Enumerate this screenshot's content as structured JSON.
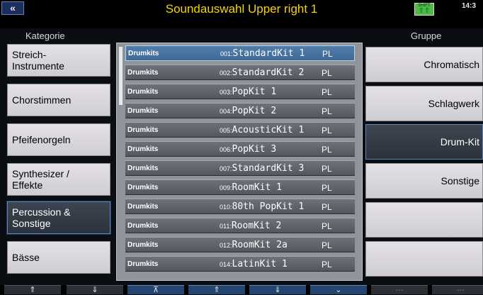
{
  "window": {
    "back_label": "«",
    "title": "Soundauswahl Upper right 1",
    "shift_label": "SHIFT",
    "shift_arrows": "⇑⇑",
    "clock": "14:3"
  },
  "headers": {
    "left": "Kategorie",
    "right": "Gruppe"
  },
  "categories": [
    {
      "label": "Streich-\nInstrumente"
    },
    {
      "label": "Chorstimmen"
    },
    {
      "label": "Pfeifenorgeln"
    },
    {
      "label": "Synthesizer /\nEffekte"
    },
    {
      "label": "Percussion &\nSonstige",
      "active": true
    },
    {
      "label": "Bässe"
    }
  ],
  "sounds": [
    {
      "category": "Drumkits",
      "num": "001:",
      "name": "StandardKit 1",
      "tag": "PL",
      "selected": true
    },
    {
      "category": "Drumkits",
      "num": "002:",
      "name": "StandardKit 2",
      "tag": "PL"
    },
    {
      "category": "Drumkits",
      "num": "003:",
      "name": "PopKit 1",
      "tag": "PL"
    },
    {
      "category": "Drumkits",
      "num": "004:",
      "name": "PopKit 2",
      "tag": "PL"
    },
    {
      "category": "Drumkits",
      "num": "005:",
      "name": "AcousticKit 1",
      "tag": "PL"
    },
    {
      "category": "Drumkits",
      "num": "006:",
      "name": "PopKit 3",
      "tag": "PL"
    },
    {
      "category": "Drumkits",
      "num": "007:",
      "name": "StandardKit 3",
      "tag": "PL"
    },
    {
      "category": "Drumkits",
      "num": "009:",
      "name": "RoomKit 1",
      "tag": "PL"
    },
    {
      "category": "Drumkits",
      "num": "010:",
      "name": "80th PopKit 1",
      "tag": "PL"
    },
    {
      "category": "Drumkits",
      "num": "011:",
      "name": "RoomKit 2",
      "tag": "PL"
    },
    {
      "category": "Drumkits",
      "num": "012:",
      "name": "RoomKit 2a",
      "tag": "PL"
    },
    {
      "category": "Drumkits",
      "num": "014:",
      "name": "LatinKit 1",
      "tag": "PL"
    }
  ],
  "groups": [
    {
      "label": "Chromatisch"
    },
    {
      "label": "Schlagwerk"
    },
    {
      "label": "Drum-Kit",
      "active": true
    },
    {
      "label": "Sonstige"
    },
    {
      "label": ""
    },
    {
      "label": ""
    }
  ],
  "nav": [
    {
      "icon": "page-up-icon",
      "glyph": "⇑",
      "style": "dark"
    },
    {
      "icon": "page-down-icon",
      "glyph": "⇓",
      "style": "dark"
    },
    {
      "icon": "first-icon",
      "glyph": "⊼",
      "style": "blue"
    },
    {
      "icon": "up-icon",
      "glyph": "⇑",
      "style": "blue"
    },
    {
      "icon": "down-icon",
      "glyph": "⇓",
      "style": "blue"
    },
    {
      "icon": "last-icon",
      "glyph": "⌄",
      "style": "blue"
    },
    {
      "icon": "empty-icon",
      "glyph": "---",
      "style": "dim"
    },
    {
      "icon": "empty-icon",
      "glyph": "---",
      "style": "dim"
    }
  ],
  "colors": {
    "accent": "#f5d400",
    "selected_row": "#4f7eab",
    "active_border": "#5c86c0"
  }
}
